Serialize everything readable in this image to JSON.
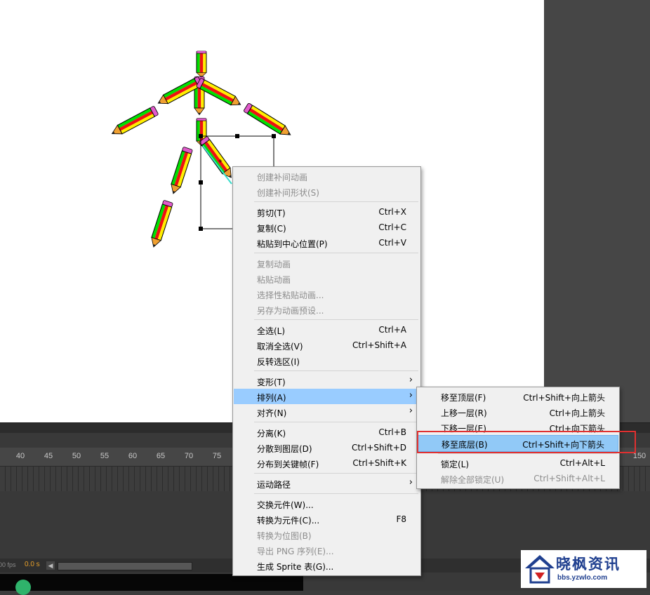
{
  "timeline": {
    "ruler_ticks": [
      "40",
      "45",
      "50",
      "55",
      "60",
      "65",
      "70",
      "75",
      "150"
    ],
    "fps": "00 fps",
    "seconds": "0.0 s"
  },
  "context_menu": {
    "items": [
      {
        "label": "创建补间动画",
        "shortcut": "",
        "disabled": true
      },
      {
        "label": "创建补间形状(S)",
        "shortcut": "",
        "disabled": true
      },
      {
        "label": "剪切(T)",
        "shortcut": "Ctrl+X"
      },
      {
        "label": "复制(C)",
        "shortcut": "Ctrl+C"
      },
      {
        "label": "粘贴到中心位置(P)",
        "shortcut": "Ctrl+V"
      },
      {
        "label": "复制动画",
        "shortcut": "",
        "disabled": true
      },
      {
        "label": "粘贴动画",
        "shortcut": "",
        "disabled": true
      },
      {
        "label": "选择性粘贴动画...",
        "shortcut": "",
        "disabled": true
      },
      {
        "label": "另存为动画预设...",
        "shortcut": "",
        "disabled": true
      },
      {
        "label": "全选(L)",
        "shortcut": "Ctrl+A"
      },
      {
        "label": "取消全选(V)",
        "shortcut": "Ctrl+Shift+A"
      },
      {
        "label": "反转选区(I)",
        "shortcut": ""
      },
      {
        "label": "变形(T)",
        "shortcut": ""
      },
      {
        "label": "排列(A)",
        "shortcut": "",
        "highlighted": true
      },
      {
        "label": "对齐(N)",
        "shortcut": ""
      },
      {
        "label": "分离(K)",
        "shortcut": "Ctrl+B"
      },
      {
        "label": "分散到图层(D)",
        "shortcut": "Ctrl+Shift+D"
      },
      {
        "label": "分布到关键帧(F)",
        "shortcut": "Ctrl+Shift+K"
      },
      {
        "label": "运动路径",
        "shortcut": ""
      },
      {
        "label": "交换元件(W)...",
        "shortcut": ""
      },
      {
        "label": "转换为元件(C)...",
        "shortcut": "F8"
      },
      {
        "label": "转换为位图(B)",
        "shortcut": "",
        "disabled": true
      },
      {
        "label": "导出 PNG 序列(E)...",
        "shortcut": "",
        "disabled": true
      },
      {
        "label": "生成 Sprite 表(G)...",
        "shortcut": ""
      }
    ]
  },
  "arrange_submenu": {
    "items": [
      {
        "label": "移至顶层(F)",
        "shortcut": "Ctrl+Shift+向上箭头"
      },
      {
        "label": "上移一层(R)",
        "shortcut": "Ctrl+向上箭头"
      },
      {
        "label": "下移一层(E)",
        "shortcut": "Ctrl+向下箭头"
      },
      {
        "label": "移至底层(B)",
        "shortcut": "Ctrl+Shift+向下箭头",
        "highlighted": true
      },
      {
        "label": "锁定(L)",
        "shortcut": "Ctrl+Alt+L"
      },
      {
        "label": "解除全部锁定(U)",
        "shortcut": "Ctrl+Shift+Alt+L",
        "disabled": true
      }
    ]
  },
  "watermark": {
    "name": "晓枫资讯",
    "url": "bbs.yzwlo.com",
    "color": "#1f3f8f"
  },
  "colors": {
    "menu_highlight": "#99ccff",
    "annotation_box": "#e03030",
    "stage": "#ffffff",
    "workspace": "#3c3c3c"
  }
}
